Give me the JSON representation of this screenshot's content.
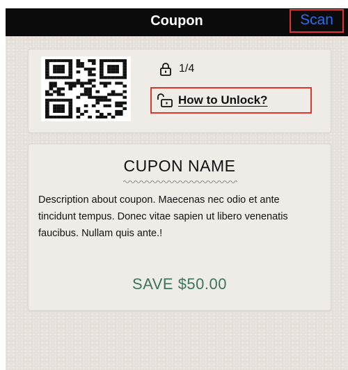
{
  "navbar": {
    "title": "Coupon",
    "scan_label": "Scan"
  },
  "unlock_panel": {
    "progress_text": "1/4",
    "how_to_unlock_label": "How to Unlock?"
  },
  "coupon": {
    "name": "CUPON NAME",
    "description": "Description about coupon. Maecenas nec odio et ante tincidunt tempus. Donec vitae sapien ut libero venenatis faucibus. Nullam quis ante.!",
    "save_text": "SAVE $50.00"
  },
  "icons": {
    "qr": "qr-code-icon",
    "lock": "lock-icon",
    "unlock": "unlock-icon"
  },
  "colors": {
    "navbar_bg": "#0b0b0b",
    "scan_link": "#2b6cf0",
    "highlight_border": "#e0362c",
    "save_green": "#3b7557",
    "background": "#e7e3dc"
  }
}
